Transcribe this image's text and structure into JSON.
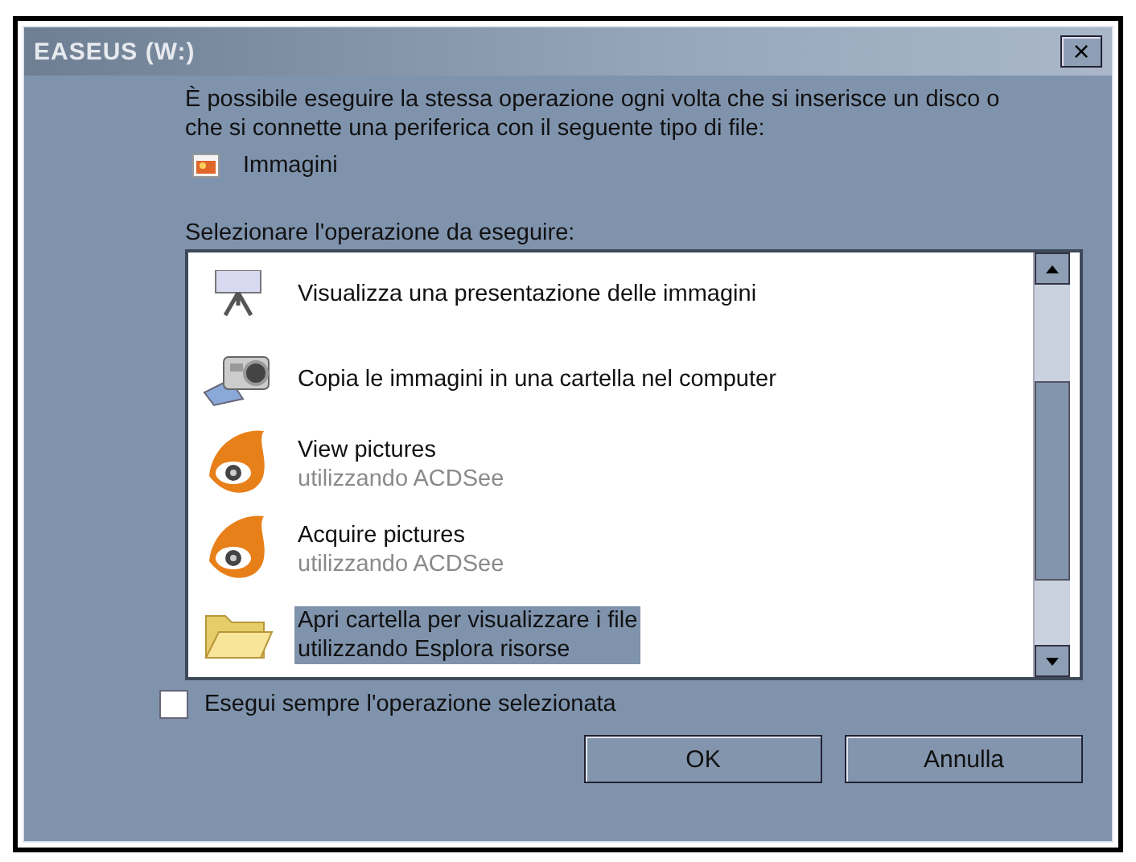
{
  "window": {
    "title": "EASEUS (W:)",
    "close": "×"
  },
  "intro": "È possibile eseguire la stessa operazione ogni volta che si inserisce un disco o che si connette una periferica con il seguente tipo di file:",
  "file_type": "Immagini",
  "prompt": "Selezionare l'operazione da eseguire:",
  "actions": [
    {
      "title": "Visualizza una presentazione delle immagini",
      "selected": false
    },
    {
      "title": "Copia le immagini in una cartella nel computer",
      "selected": false
    },
    {
      "title": "View pictures",
      "subtitle": "utilizzando ACDSee",
      "selected": false
    },
    {
      "title": "Acquire pictures",
      "subtitle": "utilizzando ACDSee",
      "selected": false
    },
    {
      "title": "Apri cartella per visualizzare i file",
      "subtitle": "utilizzando Esplora risorse",
      "selected": true
    }
  ],
  "always_do": {
    "label": "Esegui sempre l'operazione selezionata",
    "checked": false
  },
  "buttons": [
    "OK",
    "Annulla"
  ]
}
